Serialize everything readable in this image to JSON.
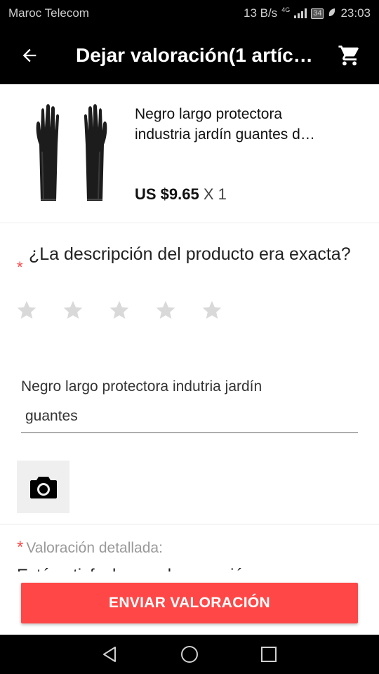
{
  "status_bar": {
    "carrier": "Maroc Telecom",
    "speed": "13 B/s",
    "network": "4G",
    "battery": "34",
    "time": "23:03"
  },
  "toolbar": {
    "title": "Dejar valoración(1 artíc…",
    "back_icon": "arrow-back-icon",
    "cart_icon": "shopping-cart-icon"
  },
  "product": {
    "title_line1": "Negro largo protectora",
    "title_line2": "industria jardín guantes d…",
    "price": "US $9.65",
    "quantity": "X 1"
  },
  "question": {
    "required_mark": "*",
    "text": "¿La descripción del producto era exacta?",
    "rating": 0,
    "max_rating": 5
  },
  "comment": {
    "line1": "Negro largo protectora indutria jardín",
    "line2": "guantes"
  },
  "photo": {
    "icon": "camera-icon"
  },
  "detailed": {
    "required_mark": "*",
    "label": "Valoración detallada:",
    "partial_text": "Está satisfecho con la conexión"
  },
  "submit": {
    "label": "ENVIAR VALORACIÓN"
  },
  "colors": {
    "accent": "#ff4747",
    "toolbar_bg": "#000000",
    "star_empty": "#d9d9d9"
  }
}
